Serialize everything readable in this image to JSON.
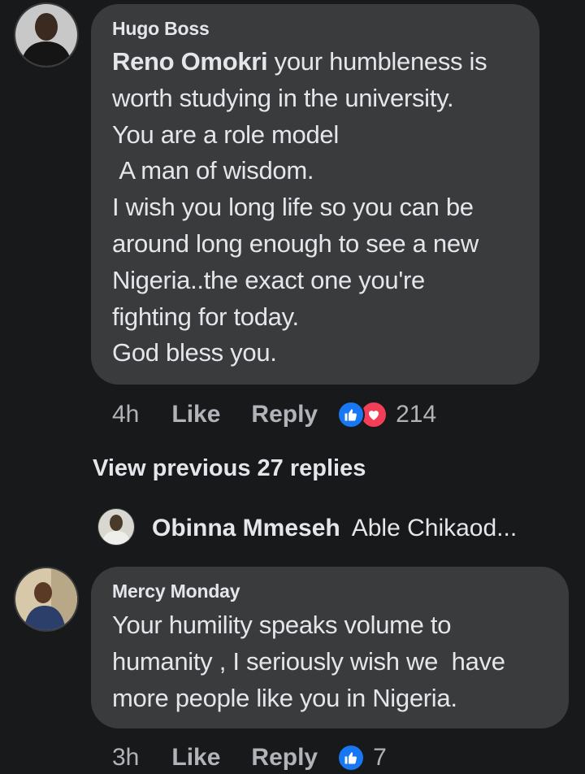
{
  "comments": [
    {
      "author": "Hugo Boss",
      "mention": "Reno Omokri",
      "text_after_mention": " your humbleness is\nworth studying in the university.\nYou are a role model\n A man of wisdom.\nI wish you long life so you can be\naround long enough to see a new\nNigeria..the exact one you're\nfighting for today.\nGod bless you.",
      "time": "4h",
      "like_label": "Like",
      "reply_label": "Reply",
      "reaction_count": "214",
      "reactions": [
        "like-icon",
        "love-icon"
      ]
    },
    {
      "author": "Mercy Monday",
      "text": "Your humility speaks volume to\nhumanity , I seriously wish we  have\nmore people like you in Nigeria.",
      "time": "3h",
      "like_label": "Like",
      "reply_label": "Reply",
      "reaction_count": "7",
      "reactions": [
        "like-icon"
      ]
    }
  ],
  "thread": {
    "view_previous_label": "View previous 27 replies",
    "latest_reply_author": "Obinna Mmeseh",
    "latest_reply_snippet": "Able Chikaod..."
  },
  "colors": {
    "background": "#18191a",
    "bubble": "#3a3b3c",
    "text": "#e4e6eb",
    "meta": "#b0b3b8",
    "like_blue": "#1877f2",
    "love_red": "#f33e58"
  }
}
